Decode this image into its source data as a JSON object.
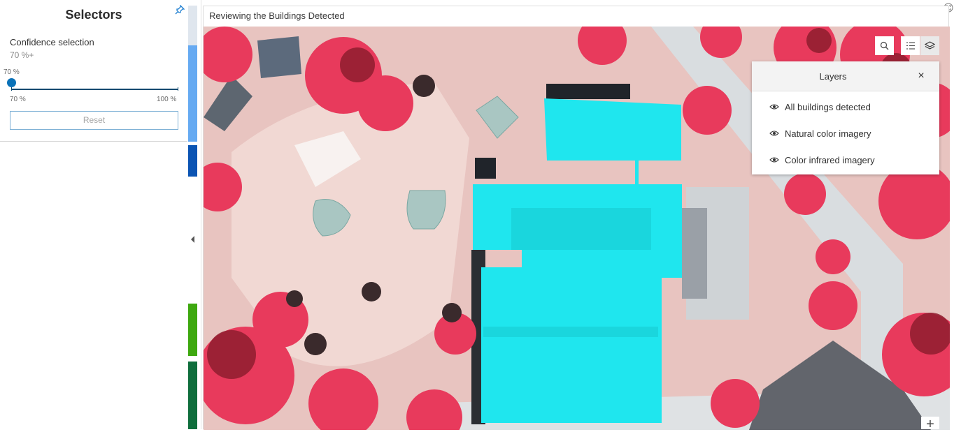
{
  "sidebar": {
    "title": "Selectors",
    "confidence_label": "Confidence selection",
    "confidence_value": "70 %+",
    "slider": {
      "current_label": "70 %",
      "min_label": "70 %",
      "max_label": "100 %",
      "value_fraction": 0.0
    },
    "reset_label": "Reset",
    "strip_colors": [
      "#66aaf2",
      "#0b54b3",
      "#3ea80f",
      "#0f6e3c"
    ]
  },
  "map": {
    "title": "Reviewing the Buildings Detected",
    "detected_building_color": "#1fe6ee"
  },
  "toolbar": {
    "search_icon": "search-icon",
    "legend_icon": "legend-list-icon",
    "layers_icon": "layers-stack-icon"
  },
  "layers_panel": {
    "title": "Layers",
    "close_label": "×",
    "items": [
      {
        "label": "All buildings detected",
        "icon": "eye-icon"
      },
      {
        "label": "Natural color imagery",
        "icon": "eye-icon"
      },
      {
        "label": "Color infrared imagery",
        "icon": "eye-icon"
      }
    ]
  },
  "zoom": {
    "in_label": "+"
  }
}
